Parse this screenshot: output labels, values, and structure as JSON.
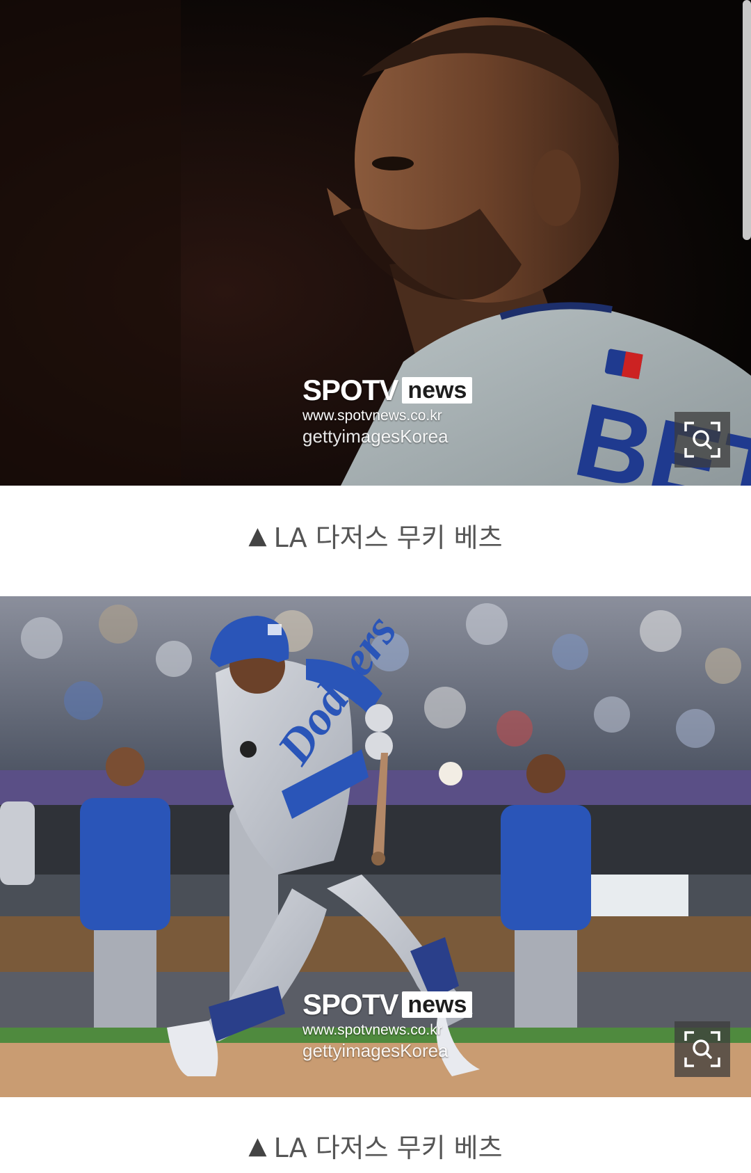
{
  "articles": [
    {
      "watermark": {
        "brand": "SPOTV",
        "brand_suffix": "news",
        "url": "www.spotvnews.co.kr",
        "agency": "gettyimagesKorea"
      },
      "zoom_icon": "zoom-search-icon",
      "caption_marker": "▲",
      "caption": "LA 다저스 무키 베츠"
    },
    {
      "watermark": {
        "brand": "SPOTV",
        "brand_suffix": "news",
        "url": "www.spotvnews.co.kr",
        "agency": "gettyimagesKorea"
      },
      "zoom_icon": "zoom-search-icon",
      "caption_marker": "▲",
      "caption": "LA 다저스 무키 베츠"
    }
  ],
  "colors": {
    "caption_text": "#555555",
    "jersey_lettering": "#1f3a8f",
    "team_blue": "#2a55b8"
  }
}
